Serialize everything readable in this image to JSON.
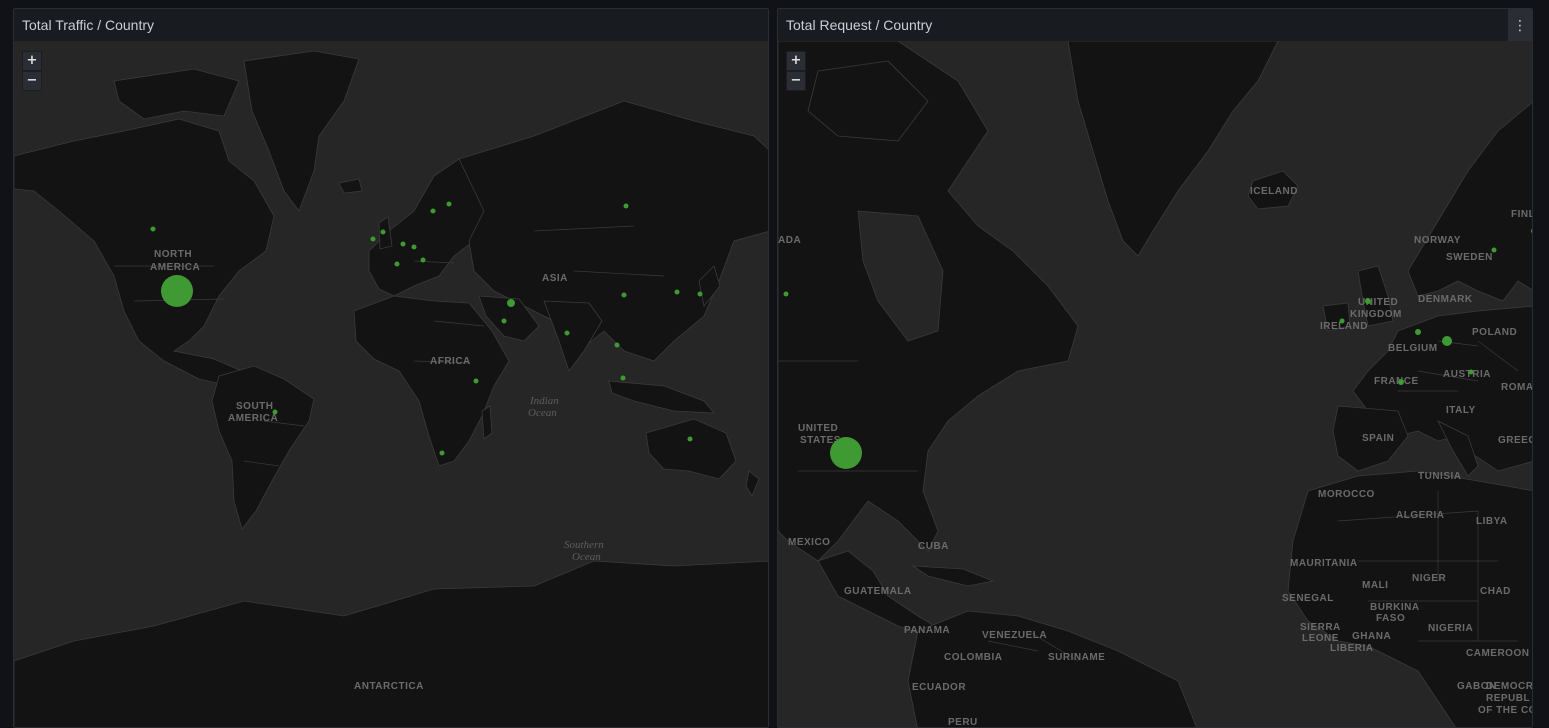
{
  "panels": [
    {
      "title": "Total Traffic / Country",
      "zoom_in": "+",
      "zoom_out": "−",
      "labels": {
        "north_america_1": "NORTH",
        "north_america_2": "AMERICA",
        "south_america_1": "SOUTH",
        "south_america_2": "AMERICA",
        "africa": "AFRICA",
        "asia": "ASIA",
        "indian_ocean_1": "Indian",
        "indian_ocean_2": "Ocean",
        "southern_ocean_1": "Southern",
        "southern_ocean_2": "Ocean",
        "antarctica": "ANTARCTICA"
      }
    },
    {
      "title": "Total Request / Country",
      "zoom_in": "+",
      "zoom_out": "−",
      "menu_icon": "⋮",
      "labels": {
        "iceland": "ICELAND",
        "canada": "ADA",
        "norway": "NORWAY",
        "sweden": "SWEDEN",
        "finland": "FINL",
        "united_kingdom_1": "UNITED",
        "united_kingdom_2": "KINGDOM",
        "ireland": "IRELAND",
        "denmark": "DENMARK",
        "poland": "POLAND",
        "belgium": "BELGIUM",
        "austria": "AUSTRIA",
        "france": "FRANCE",
        "roma": "ROMA",
        "italy": "ITALY",
        "spain": "SPAIN",
        "greece": "GREEC",
        "united_states_1": "UNITED",
        "united_states_2": "STATES",
        "tunisia": "TUNISIA",
        "morocco": "MOROCCO",
        "algeria": "ALGERIA",
        "libya": "LIBYA",
        "mauritania": "MAURITANIA",
        "mali": "MALI",
        "niger": "NIGER",
        "chad": "CHAD",
        "senegal": "SENEGAL",
        "burkina_faso_1": "BURKINA",
        "burkina_faso_2": "FASO",
        "sierra_leone_1": "SIERRA",
        "sierra_leone_2": "LEONE",
        "liberia": "LIBERIA",
        "ghana": "GHANA",
        "nigeria": "NIGERIA",
        "cameroon": "CAMEROON",
        "gabon": "GABON",
        "drc_1": "DEMOCR",
        "drc_2": "REPUBL",
        "drc_3": "OF THE CO",
        "mexico": "MEXICO",
        "cuba": "CUBA",
        "guatemala": "GUATEMALA",
        "panama": "PANAMA",
        "venezuela": "VENEZUELA",
        "colombia": "COLOMBIA",
        "suriname": "SURINAME",
        "ecuador": "ECUADOR",
        "peru": "PERU"
      }
    }
  ],
  "colors": {
    "marker": "#3f9a34",
    "map_ocean": "#262626",
    "map_land": "#131313"
  }
}
